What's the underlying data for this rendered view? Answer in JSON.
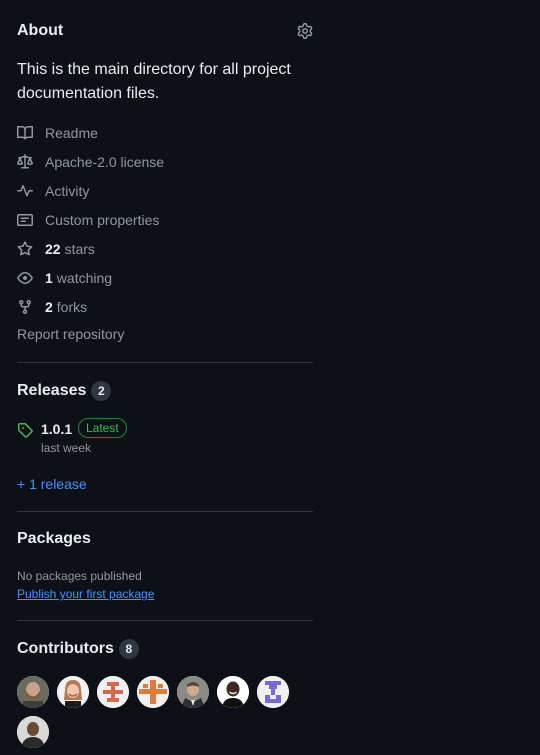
{
  "about": {
    "title": "About",
    "description": "This is the main directory for all project documentation files.",
    "readme": "Readme",
    "license": "Apache-2.0 license",
    "activity": "Activity",
    "custom_properties": "Custom properties",
    "stars_count": "22",
    "stars_label": "stars",
    "watching_count": "1",
    "watching_label": "watching",
    "forks_count": "2",
    "forks_label": "forks",
    "report": "Report repository"
  },
  "releases": {
    "title": "Releases",
    "count": "2",
    "latest_version": "1.0.1",
    "latest_badge": "Latest",
    "latest_date": "last week",
    "more_link": "+ 1 release"
  },
  "packages": {
    "title": "Packages",
    "empty_text": "No packages published",
    "publish_link": "Publish your first package"
  },
  "contributors": {
    "title": "Contributors",
    "count": "8",
    "avatars": [
      "avatar-photo-bearded-man",
      "avatar-photo-woman",
      "avatar-identicon-red",
      "avatar-identicon-orange",
      "avatar-photo-man-suit",
      "avatar-photo-man-smiling",
      "avatar-identicon-purple",
      "avatar-photo-man-dark"
    ]
  },
  "colors": {
    "background": "#0d1117",
    "text": "#e6edf3",
    "muted": "#9198a1",
    "link": "#4493f8",
    "green": "#3fb950"
  }
}
